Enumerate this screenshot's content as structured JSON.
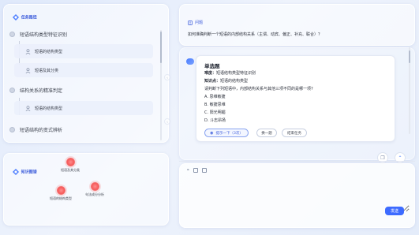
{
  "task_panel": {
    "title": "任务路径",
    "items": [
      {
        "label": "短语结构类型特征识别",
        "type": "parent"
      },
      {
        "label": "短语的结构类型",
        "type": "child"
      },
      {
        "label": "短语及其分类",
        "type": "child"
      },
      {
        "label": "结构关系的精准判定",
        "type": "parent"
      },
      {
        "label": "短语的结构类型",
        "type": "child"
      },
      {
        "label": "短语结构的变式辨析",
        "type": "parent"
      }
    ]
  },
  "knowledge_graph": {
    "title": "知识图谱",
    "nodes": [
      {
        "label": "短语及其分类"
      },
      {
        "label": "短语的结构类型"
      },
      {
        "label": "句法成分分析"
      }
    ]
  },
  "question": {
    "label": "问题",
    "text": "如何准确判断一个短语的内部结构关系（主谓、动宾、偏正、补充、联合）？"
  },
  "card": {
    "title": "单选题",
    "difficulty_label": "难度：",
    "difficulty": "短语结构类型特征识别",
    "knowledge_label": "知识点：",
    "knowledge": "短语的结构类型",
    "question": "请判断下列短语中，内部结构关系与其他三项不同的是哪一项?",
    "options": [
      "A. 思维敏捷",
      "B. 敏捷思维",
      "C. 阳光明媚",
      "D. 斗志昂扬"
    ],
    "hint_button": "提示一下（3次）",
    "change_button": "换一题",
    "end_button": "结束任务"
  },
  "input": {
    "placeholder": "",
    "send_label": "发送"
  },
  "colors": {
    "accent": "#3d6bff",
    "node": "#f55a5a"
  }
}
